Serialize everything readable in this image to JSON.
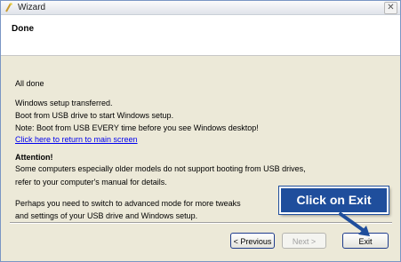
{
  "window": {
    "title": "Wizard",
    "close_glyph": "✕"
  },
  "header": {
    "title": "Done"
  },
  "content": {
    "all_done": "All done",
    "line_transferred": "Windows setup transferred.",
    "line_boot": "Boot from USB drive to start Windows setup.",
    "line_note": "Note: Boot from USB EVERY time before you see Windows desktop!",
    "return_link": "Click here to return to main screen",
    "attention_title": "Attention!",
    "attention_line1": "Some computers especially older models do not support booting from USB drives,",
    "attention_line2": "refer to your computer's manual for details.",
    "advanced_line1": "Perhaps you need to switch to advanced mode for more tweaks",
    "advanced_line2": "and settings of your USB drive and Windows setup."
  },
  "buttons": {
    "previous": "< Previous",
    "next": "Next >",
    "exit": "Exit"
  },
  "callout": {
    "text": "Click on Exit"
  },
  "colors": {
    "callout_bg": "#1f4e9c",
    "link": "#0000ee",
    "arrow": "#1f4e9c"
  },
  "icons": {
    "title_icon": "usb-wizard-icon",
    "close": "close-icon"
  }
}
